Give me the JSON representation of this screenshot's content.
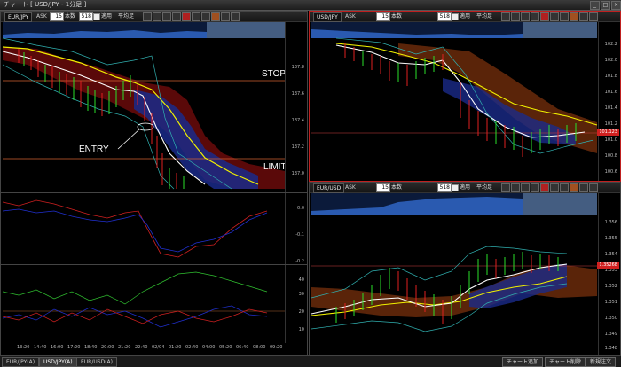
{
  "window": {
    "title": "チャート [ USD/JPY - 1分足 ]"
  },
  "toolbar": {
    "ask_label": "ASK",
    "bars_unit": "本数",
    "apply_label": "適用",
    "ma_label": "平均足"
  },
  "panels": [
    {
      "id": "usdjpy-main",
      "symbol": "EUR/JPY",
      "period": "15",
      "bars": "518",
      "selected": false,
      "y_ticks": [
        "137.8",
        "137.6",
        "137.4",
        "137.2",
        "137.0"
      ],
      "annotations": {
        "stop": "STOP",
        "limit": "LIMIT",
        "entry": "ENTRY"
      }
    },
    {
      "id": "usdjpy-right",
      "symbol": "USD/JPY",
      "period": "15",
      "bars": "518",
      "selected": true,
      "y_ticks": [
        "102.2",
        "102.0",
        "101.8",
        "101.6",
        "101.4",
        "101.2",
        "101.0",
        "100.8",
        "100.6"
      ],
      "current_price": "101.123"
    },
    {
      "id": "indicator-1",
      "y_ticks": [
        "0.0",
        "-0.1",
        "-0.2"
      ]
    },
    {
      "id": "indicator-2",
      "y_ticks": [
        "40",
        "30",
        "20",
        "10"
      ],
      "x_ticks": [
        "13:20",
        "14:40",
        "16:00",
        "17:20",
        "18:40",
        "20:00",
        "21:20",
        "22:40",
        "02/04",
        "01:20",
        "02:40",
        "04:00",
        "05:20",
        "06:40",
        "08:00",
        "09:20"
      ]
    },
    {
      "id": "eurusd",
      "symbol": "EUR/USD",
      "period": "15",
      "bars": "518",
      "selected": false,
      "y_ticks": [
        "1.356",
        "1.355",
        "1.354",
        "1.353",
        "1.352",
        "1.351",
        "1.350",
        "1.349",
        "1.348"
      ],
      "current_price": "1.35268"
    }
  ],
  "tabs": [
    "EUR/JPY(A)",
    "USD/JPY(A)",
    "EUR/USD(A)"
  ],
  "active_tab": 1,
  "buttons": {
    "add_chart": "チャート追加",
    "delete_chart": "チャート削除",
    "new_order": "新規注文"
  },
  "colors": {
    "up": "#2adf2a",
    "down": "#e02020",
    "cloud_red": "#6a0a0a",
    "cloud_blue": "#1a2a8a",
    "ma_yellow": "#f0f000",
    "ma_white": "#ffffff",
    "band_cyan": "#30b0b0",
    "selected_border": "#c02020"
  }
}
